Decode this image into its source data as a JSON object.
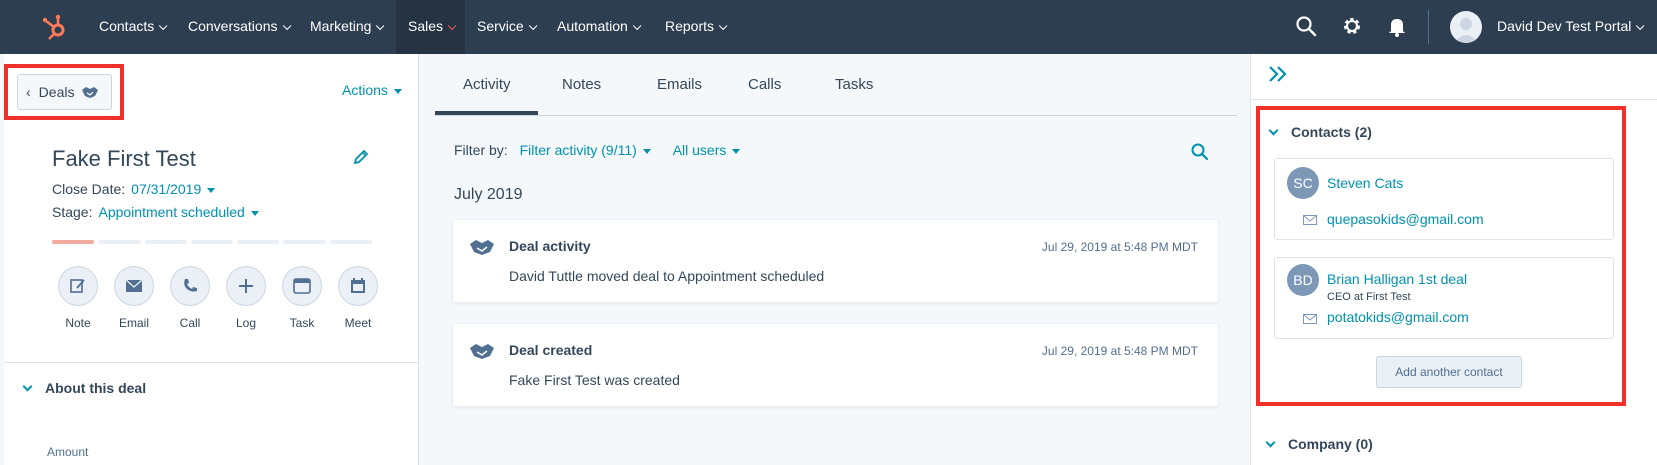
{
  "colors": {
    "nav_bg": "#2d3e50",
    "accent": "#0091ae",
    "brand": "#ff7a59",
    "highlight_box": "#f0302a"
  },
  "nav": {
    "logo_icon": "sprocket-logo",
    "items": [
      {
        "label": "Contacts"
      },
      {
        "label": "Conversations"
      },
      {
        "label": "Marketing"
      },
      {
        "label": "Sales"
      },
      {
        "label": "Service"
      },
      {
        "label": "Automation"
      },
      {
        "label": "Reports"
      }
    ],
    "active_item": "Sales",
    "icons": [
      "search-icon",
      "gear-icon",
      "bell-icon"
    ],
    "account_name": "David Dev Test Portal"
  },
  "left": {
    "back_label": "Deals",
    "actions_label": "Actions",
    "deal_name": "Fake First Test",
    "close_date_label": "Close Date:",
    "close_date_value": "07/31/2019",
    "stage_label": "Stage:",
    "stage_value": "Appointment scheduled",
    "stage_progress": {
      "completed": 1,
      "total": 7
    },
    "quick_actions": [
      {
        "label": "Note",
        "icon": "note-icon"
      },
      {
        "label": "Email",
        "icon": "email-icon"
      },
      {
        "label": "Call",
        "icon": "phone-icon"
      },
      {
        "label": "Log",
        "icon": "plus-icon"
      },
      {
        "label": "Task",
        "icon": "task-icon"
      },
      {
        "label": "Meet",
        "icon": "calendar-icon"
      }
    ],
    "about_section": "About this deal",
    "amount_label": "Amount"
  },
  "center": {
    "tabs": [
      {
        "label": "Activity"
      },
      {
        "label": "Notes"
      },
      {
        "label": "Emails"
      },
      {
        "label": "Calls"
      },
      {
        "label": "Tasks"
      }
    ],
    "active_tab": "Activity",
    "filter_label": "Filter by:",
    "filter_activity": "Filter activity (9/11)",
    "filter_users": "All users",
    "month": "July 2019",
    "activities": [
      {
        "title": "Deal activity",
        "date": "Jul 29, 2019 at 5:48 PM MDT",
        "body": "David Tuttle moved deal to Appointment scheduled"
      },
      {
        "title": "Deal created",
        "date": "Jul 29, 2019 at 5:48 PM MDT",
        "body": "Fake First Test was created"
      }
    ]
  },
  "right": {
    "contacts_title": "Contacts (2)",
    "contacts": [
      {
        "initials": "SC",
        "name": "Steven Cats",
        "subtitle": "",
        "email": "quepasokids@gmail.com"
      },
      {
        "initials": "BD",
        "name": "Brian Halligan 1st deal",
        "subtitle": "CEO at First Test",
        "email": "potatokids@gmail.com"
      }
    ],
    "add_contact_label": "Add another contact",
    "company_title": "Company (0)"
  }
}
